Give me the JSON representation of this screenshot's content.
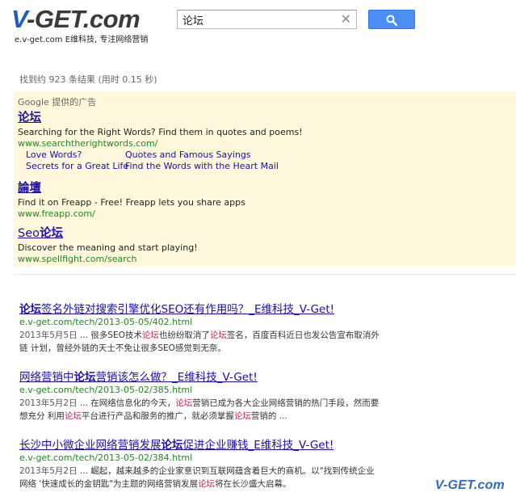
{
  "logo": {
    "mark": "V-GET.com",
    "mark_v": "V",
    "mark_rest": "-GET.com",
    "tagline": "e.v-get.com E维科技, 专注网络营销"
  },
  "search": {
    "value": "论坛",
    "clear_glyph": "✕",
    "button_icon": "search-icon"
  },
  "stats": "找到约 923 条结果 (用时 0.15 秒)",
  "ads": {
    "label": "Google 提供的广告",
    "items": [
      {
        "title": "论坛",
        "desc": "Searching for the Right Words? Find them in quotes and poems!",
        "url": "www.searchtherightwords.com/",
        "sitelinks": [
          "Love Words?",
          "Quotes and Famous Sayings",
          "Secrets for a Great Life",
          "Find the Words with the Heart Mail"
        ]
      },
      {
        "title": "論壇",
        "desc": "Find it on Freapp - Free! Freapp lets you share apps",
        "url": "www.freapp.com/"
      },
      {
        "title_pre": "Seo",
        "title_bold": "论坛",
        "desc": "Discover the meaning and start playing!",
        "url": "www.spellfight.com/search"
      }
    ]
  },
  "results": [
    {
      "title_bold": "论坛",
      "title_rest": "签名外链对搜索引擎优化SEO还有作用吗？_E维科技_V-Get!",
      "url": "e.v-get.com/tech/2013-05-05/402.html",
      "snippet_date": "2013年5月5日",
      "snippet_a": " ... 很多SEO技术",
      "snippet_hl1": "论坛",
      "snippet_b": "也纷纷取消了",
      "snippet_hl2": "论坛",
      "snippet_c": "签名，百度百科近日也发公告宣布取消外链 计划，曾经外链的天士不免让很多SEO感觉到无奈。"
    },
    {
      "title_pre": "网络营销中",
      "title_bold": "论坛",
      "title_rest": "营销该怎么做？_E维科技_V-Get!",
      "url": "e.v-get.com/tech/2013-05-02/385.html",
      "snippet_date": "2013年5月2日",
      "snippet_a": " ... 在网络信息化的今天，",
      "snippet_hl1": "论坛",
      "snippet_b": "营销已成为各大企业网络营销的热门手段，然而要想充分 利用",
      "snippet_hl2": "论坛",
      "snippet_c": "平台进行产品和服务的推广，就必须掌握",
      "snippet_hl3": "论坛",
      "snippet_d": "营销的 ..."
    },
    {
      "title_pre": "长沙中小微企业网络营销发展",
      "title_bold": "论坛",
      "title_rest": "促进企业赚钱_E维科技_V-Get!",
      "url": "e.v-get.com/tech/2013-05-02/384.html",
      "snippet_date": "2013年5月2日",
      "snippet_a": " ... 崛起，越来越多的企业家意识到互联网蕴含着巨大的商机。以\"找到传统企业网络 '快速成长的金钥匙\"为主题的网络营销发展",
      "snippet_hl1": "论坛",
      "snippet_b": "将在长沙盛大启幕。"
    }
  ],
  "watermark": "V-GET.com",
  "colors": {
    "link": "#1a0dab",
    "url": "#1e8a1e",
    "ad_bg": "#fff8dd",
    "button": "#4c8ef5",
    "highlight": "#c7254e"
  }
}
